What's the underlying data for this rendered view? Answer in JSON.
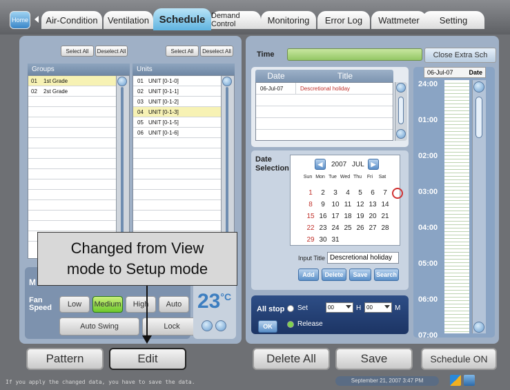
{
  "tabs": {
    "home": "Home",
    "items": [
      "Air-Condition",
      "Ventilation",
      "Schedule",
      "Demand Control",
      "Monitoring",
      "Error Log",
      "Wattmeter",
      "Setting"
    ]
  },
  "groups": {
    "select_all": "Select All",
    "deselect_all": "Deselect All",
    "header": "Groups",
    "rows": [
      [
        "01",
        "1st Grade"
      ],
      [
        "02",
        "2st Grade"
      ]
    ]
  },
  "units": {
    "select_all": "Select All",
    "deselect_all": "Deselect All",
    "header": "Units",
    "rows": [
      [
        "01",
        "UNIT [0-1-0]"
      ],
      [
        "02",
        "UNIT [0-1-1]"
      ],
      [
        "03",
        "UNIT [0-1-2]"
      ],
      [
        "04",
        "UNIT [0-1-3]"
      ],
      [
        "05",
        "UNIT [0-1-5]"
      ],
      [
        "06",
        "UNIT [0-1-6]"
      ]
    ]
  },
  "control": {
    "mode_label": "M",
    "fan_label_1": "Fan",
    "fan_label_2": "Speed",
    "fan_low": "Low",
    "fan_medium": "Medium",
    "fan_high": "High",
    "fan_auto": "Auto",
    "temperature": "23",
    "temp_unit": "°C",
    "auto_swing": "Auto Swing",
    "lock": "Lock"
  },
  "callout": {
    "line1": "Changed from View",
    "line2": "mode to Setup mode"
  },
  "schedule": {
    "time_label": "Time",
    "close_extra": "Close Extra Sch",
    "date_header": "Date",
    "title_header": "Title",
    "entries": [
      [
        "06-Jul-07",
        "Descretional holiday"
      ]
    ],
    "date_selection_1": "Date",
    "date_selection_2": "Selection",
    "cal_year": "2007",
    "cal_month": "JUL",
    "weekdays": [
      "Sun",
      "Mon",
      "Tue",
      "Wed",
      "Thu",
      "Fri",
      "Sat"
    ],
    "weeks": [
      [
        "1",
        "2",
        "3",
        "4",
        "5",
        "6",
        "7"
      ],
      [
        "8",
        "9",
        "10",
        "11",
        "12",
        "13",
        "14"
      ],
      [
        "15",
        "16",
        "17",
        "18",
        "19",
        "20",
        "21"
      ],
      [
        "22",
        "23",
        "24",
        "25",
        "26",
        "27",
        "28"
      ],
      [
        "29",
        "30",
        "31",
        "",
        "",
        "",
        ""
      ]
    ],
    "selected_day": "6",
    "input_title_label": "Input Title",
    "input_title_value": "Descretional holiday",
    "btn_add": "Add",
    "btn_delete": "Delete",
    "btn_save": "Save",
    "btn_search": "Search"
  },
  "timeline": {
    "date": "06-Jul-07",
    "date_label": "Date",
    "times": [
      "24:00",
      "01:00",
      "02:00",
      "03:00",
      "04:00",
      "05:00",
      "06:00",
      "07:00"
    ]
  },
  "allstop": {
    "label": "All stop",
    "ok": "OK",
    "set": "Set",
    "hour_value": "00",
    "h_label": "H",
    "min_value": "00",
    "m_label": "M",
    "release": "Release"
  },
  "bottom": {
    "pattern": "Pattern",
    "edit": "Edit",
    "delete_all": "Delete All",
    "save": "Save",
    "schedule_on": "Schedule ON",
    "hint": "If you apply the changed data,  you have to save the data.",
    "datetime": "September 21, 2007 3:47 PM"
  },
  "colors": {
    "accent": "#5fb3e0",
    "selected_row": "#f7f2b4",
    "holiday_red": "#c0302a",
    "timeline_bg": "#8aa4c4"
  }
}
